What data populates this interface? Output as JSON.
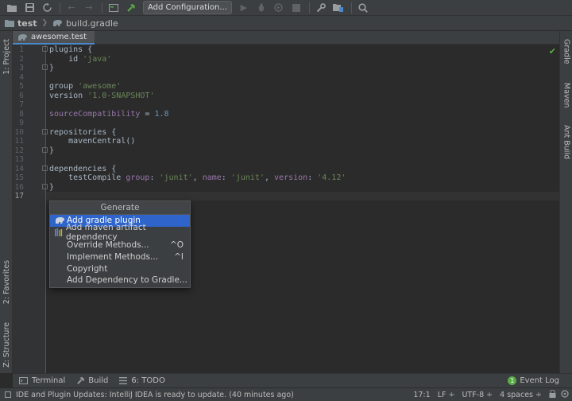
{
  "toolbar": {
    "config_label": "Add Configuration..."
  },
  "navbar": {
    "project": "test",
    "file": "build.gradle"
  },
  "left_tabs": {
    "project": "1: Project",
    "favorites": "2: Favorites",
    "structure": "Z: Structure"
  },
  "right_tabs": {
    "gradle": "Gradle",
    "maven": "Maven",
    "ant": "Ant Build"
  },
  "editor_tab": {
    "label": "awesome.test"
  },
  "editor": {
    "line_numbers": [
      "1",
      "2",
      "3",
      "4",
      "5",
      "6",
      "7",
      "8",
      "9",
      "10",
      "11",
      "12",
      "13",
      "14",
      "15",
      "16",
      "17"
    ],
    "current_line": "17",
    "lines": {
      "l1": "plugins {",
      "l2a": "    id ",
      "l2b": "'java'",
      "l3": "}",
      "l5a": "group ",
      "l5b": "'awesome'",
      "l6a": "version ",
      "l6b": "'1.0-SNAPSHOT'",
      "l8a": "sourceCompatibility",
      "l8b": " = ",
      "l8c": "1.8",
      "l10": "repositories {",
      "l11": "    mavenCentral()",
      "l12": "}",
      "l14": "dependencies {",
      "l15a": "    testCompile ",
      "l15b": "group",
      "l15c": ": ",
      "l15d": "'junit'",
      "l15e": ", ",
      "l15f": "name",
      "l15g": ": ",
      "l15h": "'junit'",
      "l15i": ", ",
      "l15j": "version",
      "l15k": ": ",
      "l15l": "'4.12'",
      "l16": "}"
    }
  },
  "generate_popup": {
    "title": "Generate",
    "items": [
      {
        "label": "Add gradle plugin",
        "shortcut": "",
        "icon": "gradle-elephant-icon"
      },
      {
        "label": "Add maven artifact dependency",
        "shortcut": "",
        "icon": "maven-bars-icon"
      },
      {
        "label": "Override Methods...",
        "shortcut": "^O"
      },
      {
        "label": "Implement Methods...",
        "shortcut": "^I"
      },
      {
        "label": "Copyright",
        "shortcut": ""
      },
      {
        "label": "Add Dependency to Gradle...",
        "shortcut": ""
      }
    ]
  },
  "tool_windows": {
    "terminal": "Terminal",
    "build": "Build",
    "todo": "6: TODO",
    "event_log": "Event Log",
    "event_count": "1"
  },
  "status": {
    "message": "IDE and Plugin Updates: IntelliJ IDEA is ready to update. (40 minutes ago)",
    "position": "17:1",
    "line_sep": "LF ÷",
    "encoding": "UTF-8 ÷",
    "indent": "4 spaces ÷"
  },
  "colors": {
    "accent": "#2f65ca",
    "tab_underline": "#4a88c7",
    "string": "#6a8759",
    "property": "#9876aa",
    "number": "#6897bb",
    "ok": "#5aab48"
  }
}
